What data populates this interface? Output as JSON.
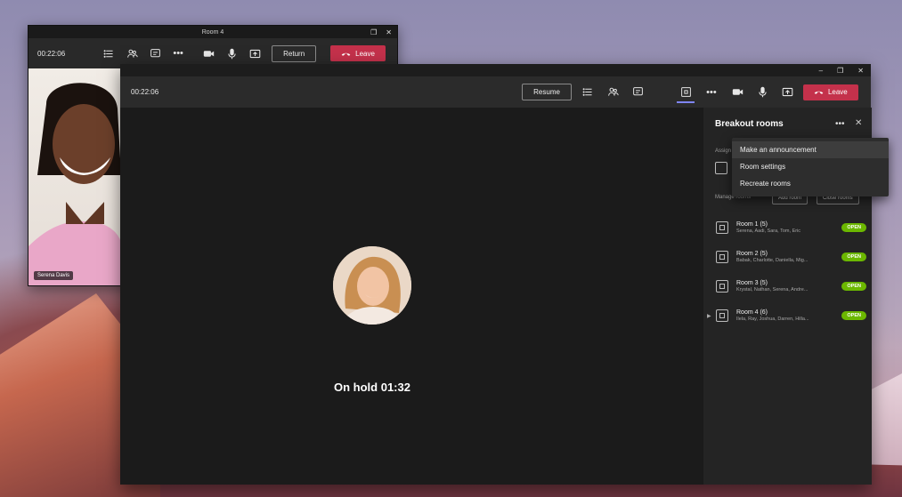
{
  "small_window": {
    "title": "Room 4",
    "timer": "00:22:06",
    "return_label": "Return",
    "leave_label": "Leave",
    "participant_name": "Serena Davis"
  },
  "main_window": {
    "timer": "00:22:06",
    "resume_label": "Resume",
    "leave_label": "Leave",
    "hold_status": "On hold 01:32"
  },
  "breakout_panel": {
    "title": "Breakout rooms",
    "assign_label": "Assign",
    "manage_label": "Manage rooms",
    "add_room_label": "Add room",
    "close_rooms_label": "Close rooms",
    "rooms": [
      {
        "name": "Room 1 (5)",
        "members": "Serena, Aadi, Sara, Tom, Eric",
        "status": "OPEN"
      },
      {
        "name": "Room 2 (5)",
        "members": "Babak, Charlotte, Daniella, Mig...",
        "status": "OPEN"
      },
      {
        "name": "Room 3 (5)",
        "members": "Krystal, Nathan, Serena, Andre...",
        "status": "OPEN"
      },
      {
        "name": "Room 4 (6)",
        "members": "Ilela, Ray, Joshua, Darren, Hilla...",
        "status": "OPEN"
      }
    ]
  },
  "dropdown_menu": {
    "items": [
      "Make an announcement",
      "Room settings",
      "Recreate rooms"
    ]
  },
  "colors": {
    "leave_red": "#c4314b",
    "open_green": "#6bb700",
    "accent": "#7f85f5"
  }
}
